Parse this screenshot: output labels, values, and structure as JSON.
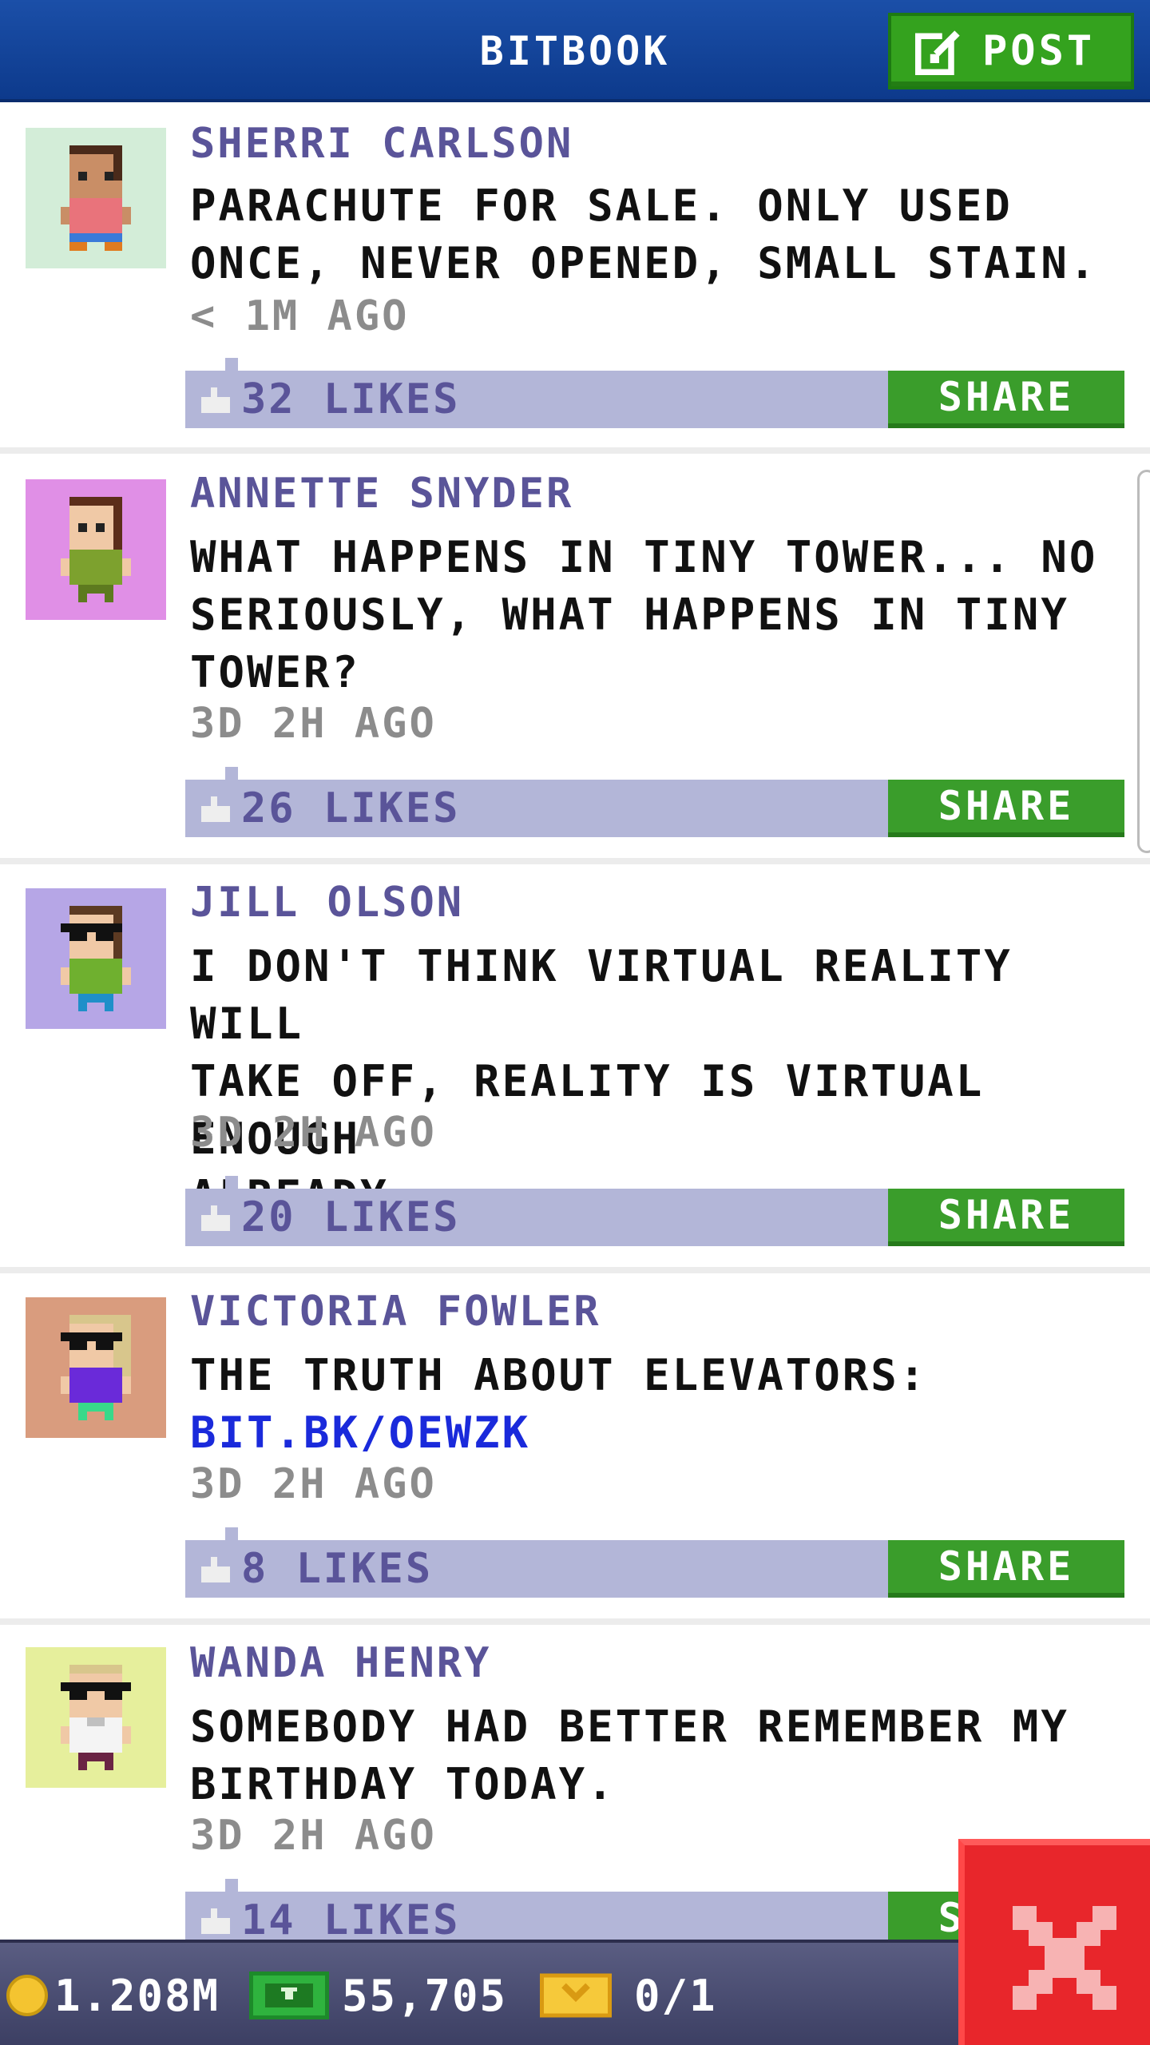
{
  "header": {
    "title": "BITBOOK",
    "post_label": "POST"
  },
  "colors": {
    "header_blue": "#0d3a8c",
    "green": "#3a9d2b",
    "like_bar": "#b3b6d8",
    "author": "#5a5499",
    "link": "#1a2adb",
    "close_red": "#e8262b"
  },
  "posts": [
    {
      "author": "SHERRI CARLSON",
      "lines": [
        "PARACHUTE FOR SALE. ONLY USED",
        "ONCE, NEVER OPENED, SMALL STAIN."
      ],
      "time": "< 1M AGO",
      "likes": "32 LIKES",
      "share": "SHARE",
      "avatar_bg": "#d3edd8",
      "avatar_icon": "woman-pink-shirt-avatar"
    },
    {
      "author": "ANNETTE SNYDER",
      "lines": [
        "WHAT HAPPENS IN TINY TOWER... NO",
        "SERIOUSLY, WHAT HAPPENS IN TINY",
        "TOWER?"
      ],
      "time": "3D 2H AGO",
      "likes": "26 LIKES",
      "share": "SHARE",
      "avatar_bg": "#e08fe6",
      "avatar_icon": "woman-green-shirt-avatar"
    },
    {
      "author": "JILL OLSON",
      "lines": [
        "I DON'T THINK VIRTUAL REALITY WILL",
        "TAKE OFF, REALITY IS VIRTUAL ENOUGH",
        "ALREADY."
      ],
      "time": "3D 2H AGO",
      "likes": "20 LIKES",
      "share": "SHARE",
      "avatar_bg": "#b6a6e6",
      "avatar_icon": "woman-glasses-avatar"
    },
    {
      "author": "VICTORIA FOWLER",
      "lines": [
        "THE TRUTH ABOUT ELEVATORS:"
      ],
      "link": "BIT.BK/OEWZK",
      "time": "3D 2H AGO",
      "likes": "8 LIKES",
      "share": "SHARE",
      "avatar_bg": "#d99c7e",
      "avatar_icon": "woman-sunglasses-avatar"
    },
    {
      "author": "WANDA HENRY",
      "lines": [
        "SOMEBODY HAD BETTER REMEMBER MY",
        "BIRTHDAY TODAY."
      ],
      "time": "3D 2H AGO",
      "likes": "14 LIKES",
      "share": "SHARE",
      "avatar_bg": "#e6ef9c",
      "avatar_icon": "man-sunglasses-avatar"
    }
  ],
  "status": {
    "coins": "1.208M",
    "bux": "55,705",
    "tickets": "0/1"
  },
  "close_icon": "close-icon"
}
